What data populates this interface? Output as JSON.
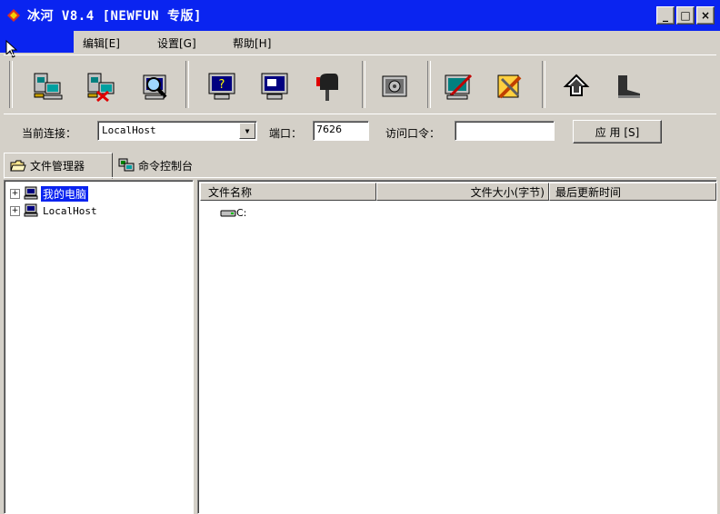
{
  "window": {
    "title": "冰河 V8.4 [NEWFUN 专版]",
    "minimize": "_",
    "maximize": "□",
    "close": "×"
  },
  "menu": {
    "edit": "编辑[E]",
    "settings": "设置[G]",
    "help": "帮助[H]"
  },
  "toolbar": {
    "buttons": [
      "add-host-icon",
      "delete-host-icon",
      "search-host-icon",
      "help-monitor-icon",
      "screen-capture-icon",
      "mailbox-icon",
      "settings-gear-icon",
      "edit-config-icon",
      "tools-icon",
      "up-arrow-icon",
      "boot-icon"
    ]
  },
  "connection": {
    "current_label": "当前连接：",
    "current_value": "LocalHost",
    "port_label": "端口：",
    "port_value": "7626",
    "password_label": "访问口令：",
    "password_value": "",
    "apply_label": "应 用 [S]"
  },
  "tabs": {
    "file_manager": "文件管理器",
    "command_console": "命令控制台"
  },
  "tree": {
    "items": [
      {
        "label": "我的电脑",
        "expander": "+",
        "selected": true
      },
      {
        "label": "LocalHost",
        "expander": "+",
        "selected": false
      }
    ]
  },
  "filelist": {
    "columns": {
      "name": "文件名称",
      "size": "文件大小(字节)",
      "modified": "最后更新时间"
    },
    "rows": [
      {
        "name": "C:"
      }
    ]
  },
  "colors": {
    "titlebar": "#0a24f0",
    "face": "#d4d0c8",
    "selection": "#0a24f0"
  }
}
